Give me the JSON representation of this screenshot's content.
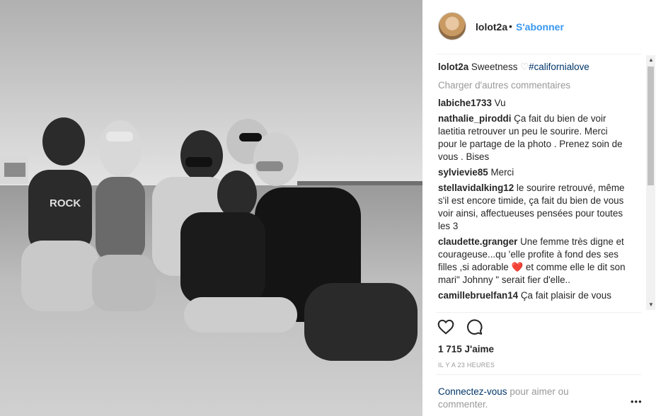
{
  "post": {
    "username": "lolot2a",
    "separator": "•",
    "follow_label": "S'abonner"
  },
  "caption": {
    "username": "lolot2a",
    "text": "Sweetness ",
    "emoji": "♡",
    "hashtag": "#californialove"
  },
  "load_more_label": "Charger d'autres commentaires",
  "comments": [
    {
      "user": "labiche1733",
      "text": "Vu"
    },
    {
      "user": "nathalie_piroddi",
      "text": "Ça fait du bien de voir laetitia retrouver un peu le sourire. Merci pour le partage de la photo . Prenez soin de vous . Bises"
    },
    {
      "user": "sylvievie85",
      "text": "Merci"
    },
    {
      "user": "stellavidalking12",
      "text": "le sourire retrouvé, même s'il est encore timide, ça fait du bien de vous voir ainsi, affectueuses pensées pour toutes les 3"
    },
    {
      "user": "claudette.granger",
      "text_a": "Une femme très digne et courageuse...qu 'elle profite à fond des ses filles ,si adorable ",
      "emoji": "❤️",
      "text_b": " et comme elle le dit son mari\" Johnny \" serait fier d'elle.."
    },
    {
      "user": "camillebruelfan14",
      "text": "Ça fait plaisir de vous"
    }
  ],
  "actions": {
    "like_icon": "heart-outline-icon",
    "comment_icon": "comment-bubble-icon"
  },
  "likes_label": "1 715 J'aime",
  "timestamp": "IL Y A 23 HEURES",
  "login": {
    "link": "Connectez-vous",
    "rest": " pour aimer ou commenter."
  },
  "more_label": "•••",
  "scrollbar": {
    "up": "▲",
    "down": "▼"
  },
  "colors": {
    "link_blue": "#3897f0",
    "hashtag": "#003569",
    "muted": "#999999",
    "text": "#262626"
  }
}
